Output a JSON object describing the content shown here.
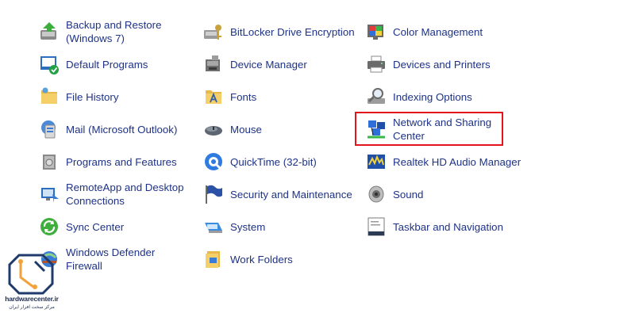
{
  "items": {
    "backup_restore": "Backup and Restore\n(Windows 7)",
    "default_programs": "Default Programs",
    "file_history": "File History",
    "mail": "Mail (Microsoft Outlook)",
    "programs_features": "Programs and Features",
    "remoteapp": "RemoteApp and Desktop\nConnections",
    "sync_center": "Sync Center",
    "windows_defender": "Windows Defender\nFirewall",
    "bitlocker": "BitLocker Drive Encryption",
    "device_manager": "Device Manager",
    "fonts": "Fonts",
    "mouse": "Mouse",
    "quicktime": "QuickTime (32-bit)",
    "security_maintenance": "Security and Maintenance",
    "system": "System",
    "work_folders": "Work Folders",
    "color_management": "Color Management",
    "devices_printers": "Devices and Printers",
    "indexing_options": "Indexing Options",
    "network_sharing": "Network and Sharing\nCenter",
    "realtek_audio": "Realtek HD Audio Manager",
    "sound": "Sound",
    "taskbar_navigation": "Taskbar and Navigation"
  },
  "highlight": {
    "item": "network_sharing",
    "color": "#e3141b"
  },
  "watermark": {
    "brand": "hardwarecenter.ir",
    "subtitle": "مرکز سخت افزار ایران"
  },
  "colors": {
    "link_text": "#1e3287",
    "background": "#ffffff"
  }
}
